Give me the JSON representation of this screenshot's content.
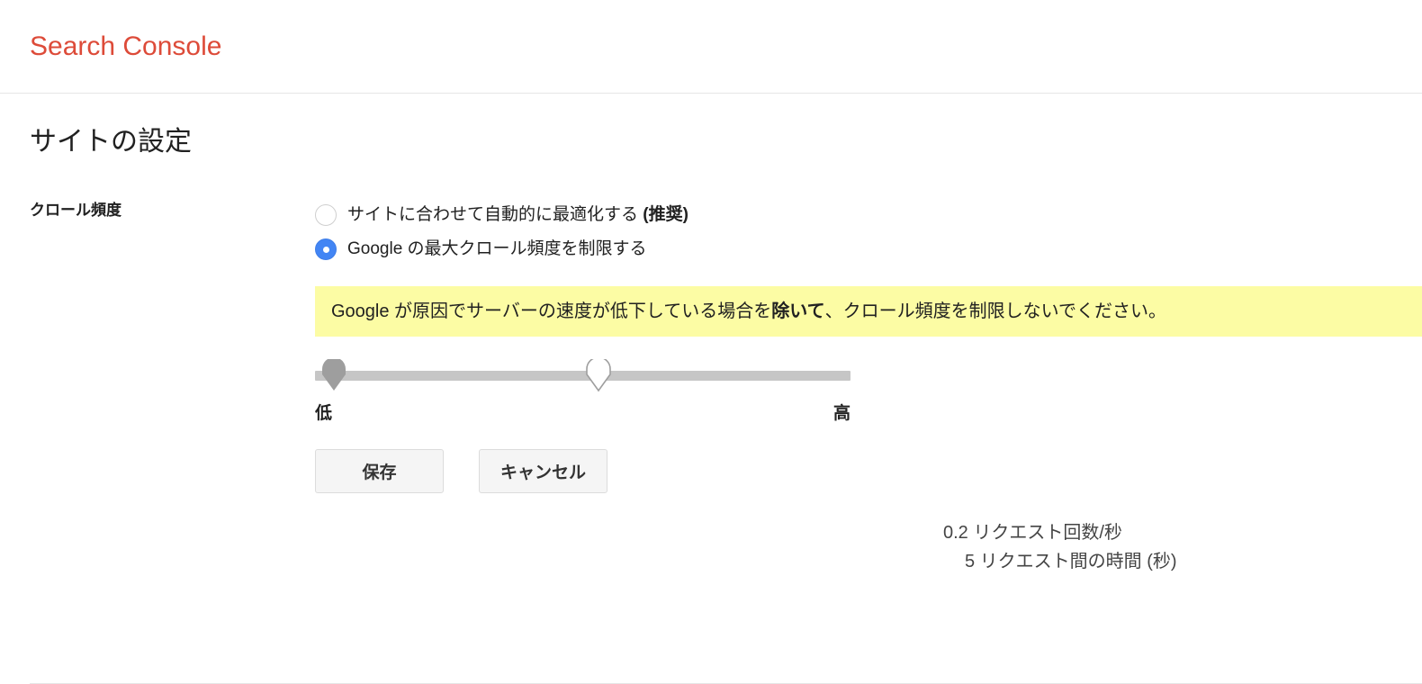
{
  "header": {
    "app_title": "Search Console",
    "brand_color": "#dd4b39"
  },
  "page": {
    "title": "サイトの設定"
  },
  "crawl_rate": {
    "row_label": "クロール頻度",
    "options": [
      {
        "id": "auto",
        "label_main": "サイトに合わせて自動的に最適化する ",
        "label_bold": "(推奨)",
        "selected": false
      },
      {
        "id": "limit",
        "label_main": "Google の最大クロール頻度を制限する",
        "label_bold": "",
        "selected": true
      }
    ],
    "selected_option": "limit",
    "warning": {
      "text_before": "Google が原因でサーバーの速度が低下している場合を",
      "text_bold": "除いて",
      "text_after": "、クロール頻度を制限しないでください。",
      "background_color": "#fcfca4"
    },
    "slider": {
      "min_label": "低",
      "max_label": "高",
      "min_marker_percent": 0,
      "value_percent": 53,
      "track_color": "#c6c6c6",
      "min_pin_color": "#9e9e9e"
    },
    "readout": {
      "requests_per_second": "0.2 リクエスト回数/秒",
      "seconds_between_requests": "5 リクエスト間の時間 (秒)"
    },
    "buttons": {
      "save": "保存",
      "cancel": "キャンセル"
    }
  }
}
